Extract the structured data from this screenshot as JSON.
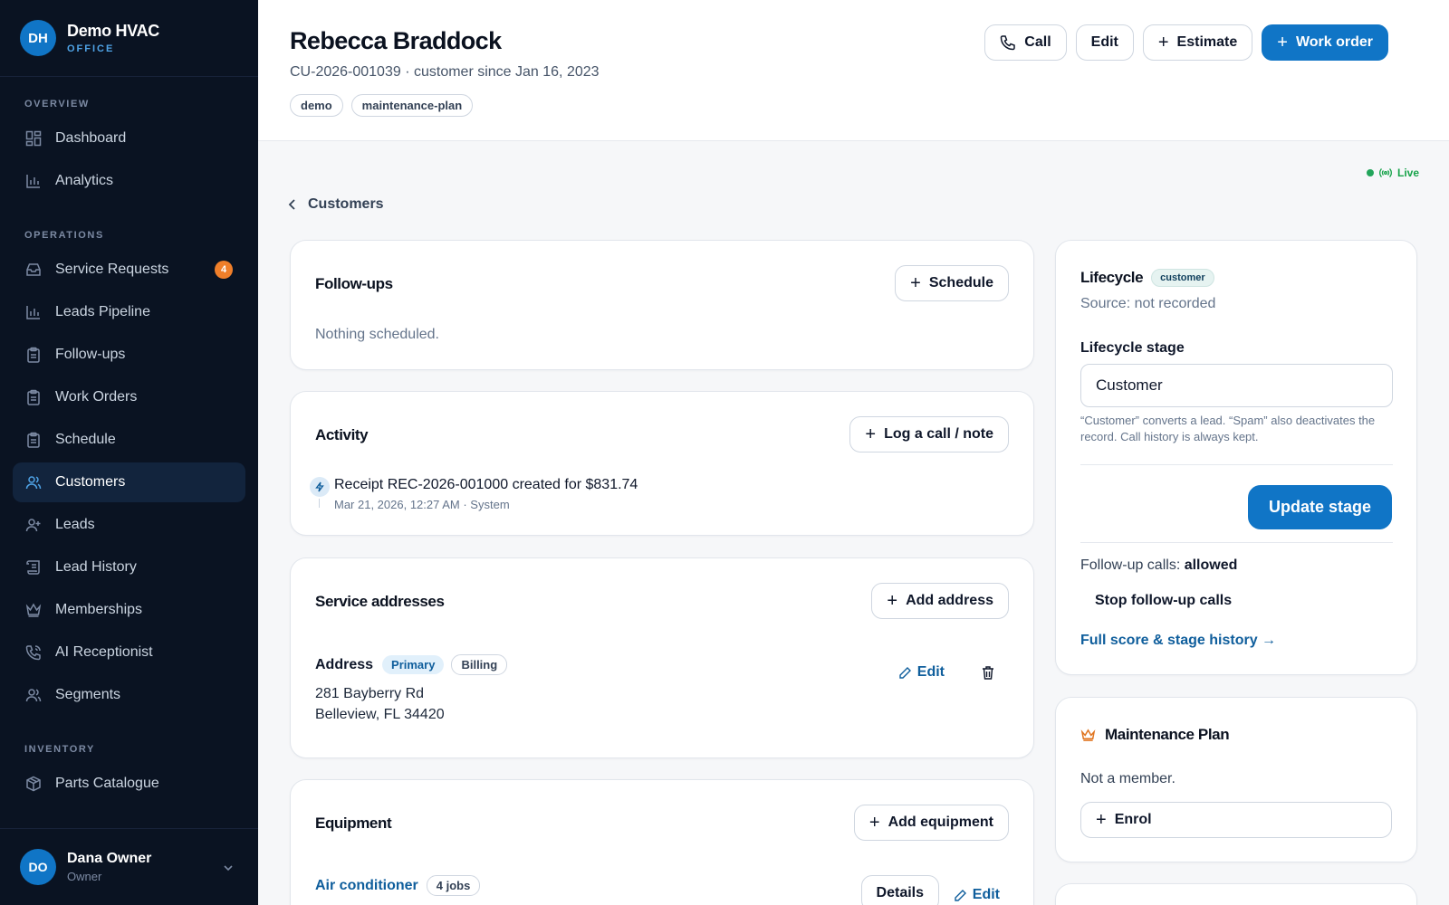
{
  "brand": {
    "initials": "DH",
    "name": "Demo HVAC",
    "sub": "OFFICE"
  },
  "sidebar": {
    "overview_label": "OVERVIEW",
    "operations_label": "OPERATIONS",
    "inventory_label": "INVENTORY",
    "items": [
      {
        "label": "Dashboard",
        "icon": "grid-icon"
      },
      {
        "label": "Analytics",
        "icon": "bar-chart-icon"
      },
      {
        "label": "Service Requests",
        "icon": "inbox-icon",
        "badge": "4"
      },
      {
        "label": "Leads Pipeline",
        "icon": "bar-chart-icon"
      },
      {
        "label": "Follow-ups",
        "icon": "clipboard-icon"
      },
      {
        "label": "Work Orders",
        "icon": "clipboard-icon"
      },
      {
        "label": "Schedule",
        "icon": "clipboard-icon"
      },
      {
        "label": "Customers",
        "icon": "users-icon",
        "active": true
      },
      {
        "label": "Leads",
        "icon": "user-plus-icon"
      },
      {
        "label": "Lead History",
        "icon": "scroll-icon"
      },
      {
        "label": "Memberships",
        "icon": "crown-icon"
      },
      {
        "label": "AI Receptionist",
        "icon": "phone-icon"
      },
      {
        "label": "Segments",
        "icon": "users-icon"
      },
      {
        "label": "Parts Catalogue",
        "icon": "box-icon"
      }
    ]
  },
  "user": {
    "initials": "DO",
    "name": "Dana Owner",
    "role": "Owner"
  },
  "header": {
    "name": "Rebecca Braddock",
    "meta": "CU-2026-001039 · customer since Jan 16, 2023",
    "tags": [
      "demo",
      "maintenance-plan"
    ],
    "actions": {
      "call": "Call",
      "edit": "Edit",
      "estimate": "Estimate",
      "work_order": "Work order"
    }
  },
  "live": "Live",
  "back": "Customers",
  "followups": {
    "title": "Follow-ups",
    "button": "Schedule",
    "empty": "Nothing scheduled."
  },
  "activity": {
    "title": "Activity",
    "button": "Log a call / note",
    "entries": [
      {
        "text": "Receipt REC-2026-001000 created for $831.74",
        "meta": "Mar 21, 2026, 12:27 AM · System"
      }
    ]
  },
  "addresses": {
    "title": "Service addresses",
    "button": "Add address",
    "label": "Address",
    "badges": [
      "Primary",
      "Billing"
    ],
    "line1": "281 Bayberry Rd",
    "line2": "Belleview, FL 34420",
    "edit": "Edit"
  },
  "equipment": {
    "title": "Equipment",
    "button": "Add equipment",
    "item": "Air conditioner",
    "jobs": "4 jobs",
    "details": "Details",
    "edit": "Edit"
  },
  "lifecycle": {
    "title": "Lifecycle",
    "badge": "customer",
    "source": "Source: not recorded",
    "stage_label": "Lifecycle stage",
    "stage_value": "Customer",
    "help": "“Customer” converts a lead. “Spam” also deactivates the record. Call history is always kept.",
    "update": "Update stage",
    "followup_prefix": "Follow-up calls: ",
    "followup_value": "allowed",
    "stop": "Stop follow-up calls",
    "history": "Full score & stage history →"
  },
  "maintenance": {
    "title": "Maintenance Plan",
    "status": "Not a member.",
    "enrol": "Enrol"
  },
  "colors": {
    "accent": "#1075c6",
    "sidebar": "#0a1322",
    "badge": "#f07f2a",
    "live": "#22a55b"
  }
}
